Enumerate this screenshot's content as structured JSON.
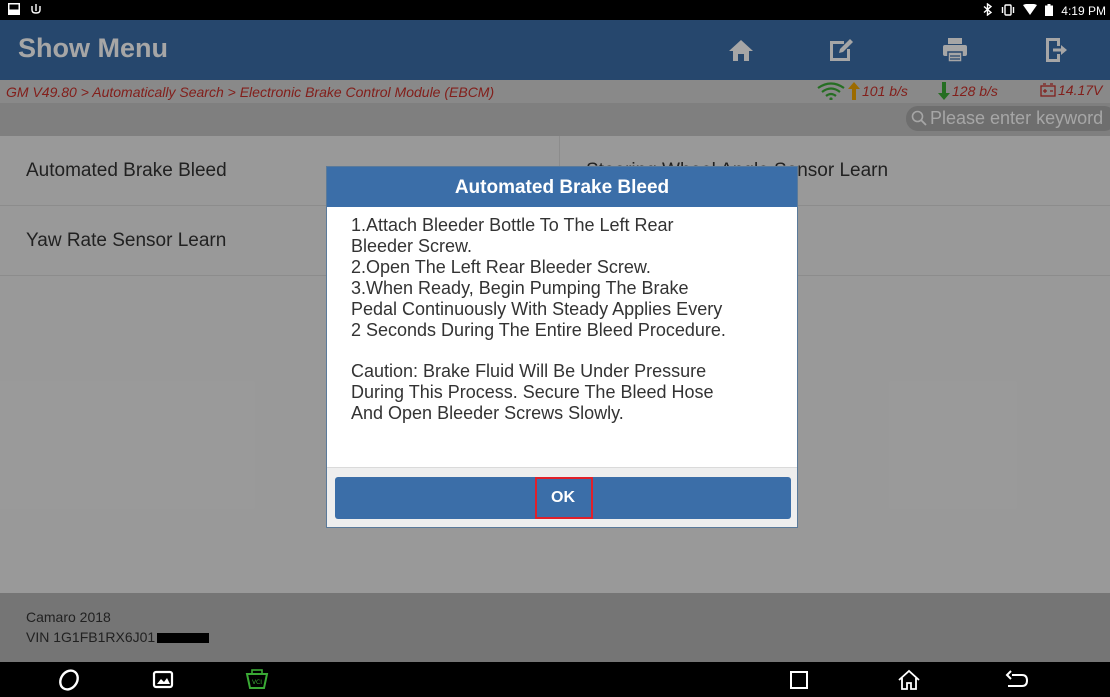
{
  "status_bar": {
    "time": "4:19 PM"
  },
  "header": {
    "title": "Show Menu",
    "buttons": [
      "home-icon",
      "edit-icon",
      "print-icon",
      "exit-icon"
    ]
  },
  "breadcrumb": {
    "path": "GM V49.80 > Automatically Search > Electronic Brake Control Module (EBCM)",
    "upload_rate": "101 b/s",
    "download_rate": "128 b/s",
    "voltage": "14.17V"
  },
  "search": {
    "placeholder": "Please enter keyword"
  },
  "menu_items": [
    "Automated Brake Bleed",
    "Steering Wheel Angle Sensor Learn",
    "Yaw Rate Sensor Learn"
  ],
  "footer": {
    "model": "Camaro 2018",
    "vin": "VIN 1G1FB1RX6J01"
  },
  "dialog": {
    "title": "Automated Brake Bleed",
    "steps": "1.Attach Bleeder Bottle To The Left Rear\nBleeder Screw.\n2.Open The Left Rear Bleeder Screw.\n3.When Ready, Begin Pumping The Brake\nPedal Continuously With Steady Applies Every\n2 Seconds During The Entire Bleed Procedure.",
    "caution": "Caution: Brake Fluid Will Be Under Pressure\nDuring This Process. Secure The Bleed Hose\nAnd Open Bleeder Screws Slowly.",
    "ok_label": "OK"
  },
  "colors": {
    "header_blue": "#3b6ea8",
    "breadcrumb_red": "#c8302a",
    "highlight_red": "#e0202a",
    "net_up": "#f0a500",
    "net_down": "#3aaa35"
  }
}
